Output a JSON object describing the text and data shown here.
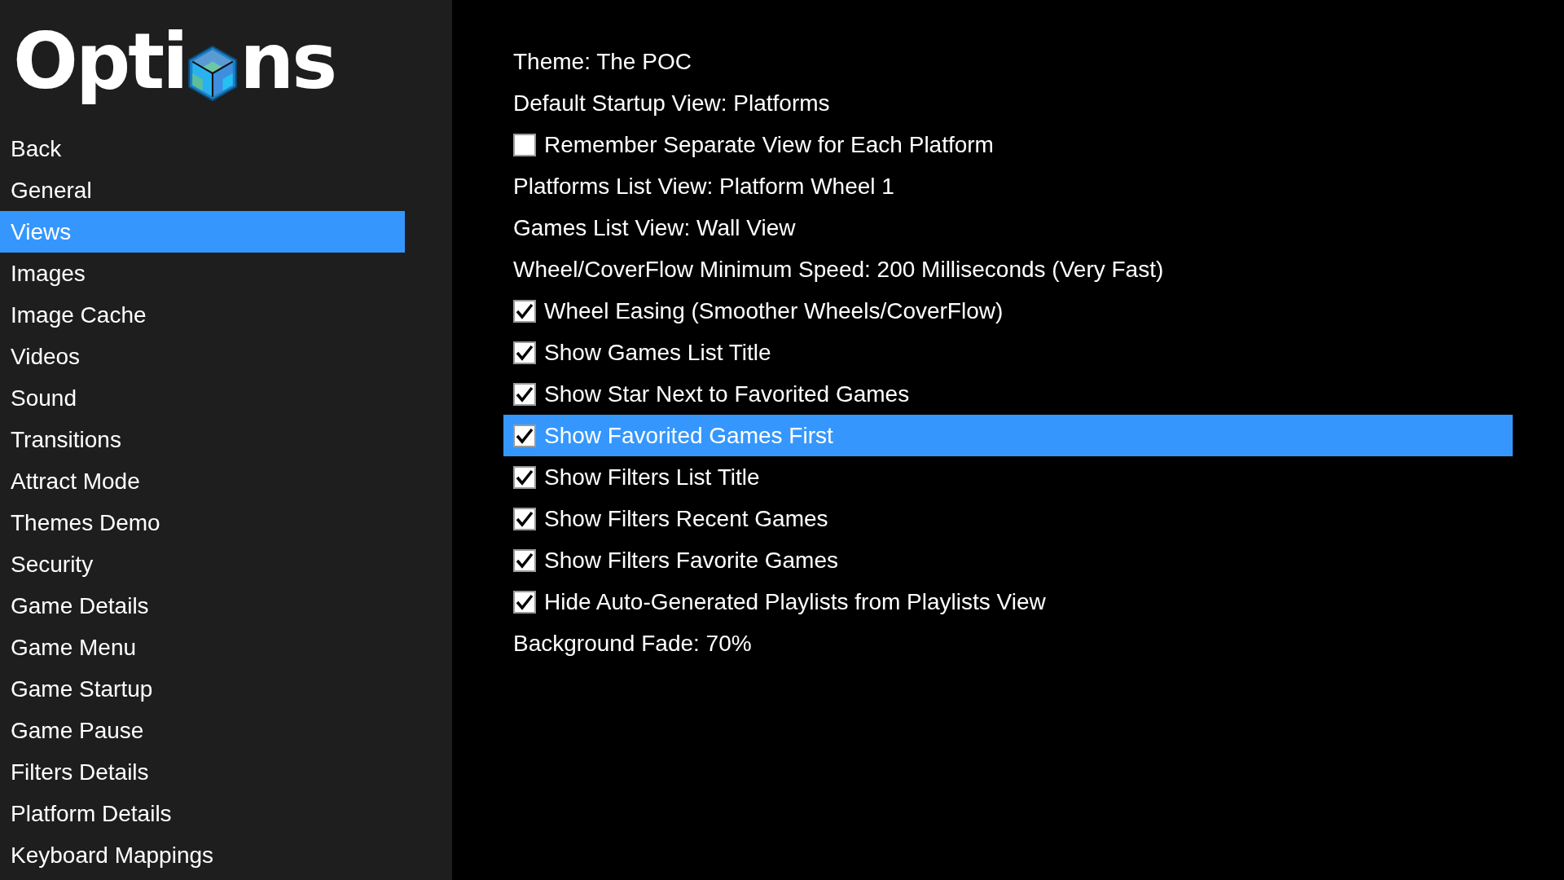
{
  "title": {
    "before": "Opti",
    "after": "ns"
  },
  "sidebar": {
    "items": [
      {
        "label": "Back",
        "selected": false
      },
      {
        "label": "General",
        "selected": false
      },
      {
        "label": "Views",
        "selected": true
      },
      {
        "label": "Images",
        "selected": false
      },
      {
        "label": "Image Cache",
        "selected": false
      },
      {
        "label": "Videos",
        "selected": false
      },
      {
        "label": "Sound",
        "selected": false
      },
      {
        "label": "Transitions",
        "selected": false
      },
      {
        "label": "Attract Mode",
        "selected": false
      },
      {
        "label": "Themes Demo",
        "selected": false
      },
      {
        "label": "Security",
        "selected": false
      },
      {
        "label": "Game Details",
        "selected": false
      },
      {
        "label": "Game Menu",
        "selected": false
      },
      {
        "label": "Game Startup",
        "selected": false
      },
      {
        "label": "Game Pause",
        "selected": false
      },
      {
        "label": "Filters Details",
        "selected": false
      },
      {
        "label": "Platform Details",
        "selected": false
      },
      {
        "label": "Keyboard Mappings",
        "selected": false
      }
    ]
  },
  "settings": [
    {
      "kind": "value",
      "label": "Theme: The POC",
      "selected": false
    },
    {
      "kind": "value",
      "label": "Default Startup View: Platforms",
      "selected": false
    },
    {
      "kind": "checkbox",
      "label": "Remember Separate View for Each Platform",
      "checked": false,
      "selected": false
    },
    {
      "kind": "value",
      "label": "Platforms List View: Platform Wheel 1",
      "selected": false
    },
    {
      "kind": "value",
      "label": "Games List View: Wall View",
      "selected": false
    },
    {
      "kind": "value",
      "label": "Wheel/CoverFlow Minimum Speed: 200 Milliseconds (Very Fast)",
      "selected": false
    },
    {
      "kind": "checkbox",
      "label": "Wheel Easing (Smoother Wheels/CoverFlow)",
      "checked": true,
      "selected": false
    },
    {
      "kind": "checkbox",
      "label": "Show Games List Title",
      "checked": true,
      "selected": false
    },
    {
      "kind": "checkbox",
      "label": "Show Star Next to Favorited Games",
      "checked": true,
      "selected": false
    },
    {
      "kind": "checkbox",
      "label": "Show Favorited Games First",
      "checked": true,
      "selected": true
    },
    {
      "kind": "checkbox",
      "label": "Show Filters List Title",
      "checked": true,
      "selected": false
    },
    {
      "kind": "checkbox",
      "label": "Show Filters Recent Games",
      "checked": true,
      "selected": false
    },
    {
      "kind": "checkbox",
      "label": "Show Filters Favorite Games",
      "checked": true,
      "selected": false
    },
    {
      "kind": "checkbox",
      "label": "Hide Auto-Generated Playlists from Playlists View",
      "checked": true,
      "selected": false
    },
    {
      "kind": "value",
      "label": "Background Fade: 70%",
      "selected": false
    }
  ]
}
